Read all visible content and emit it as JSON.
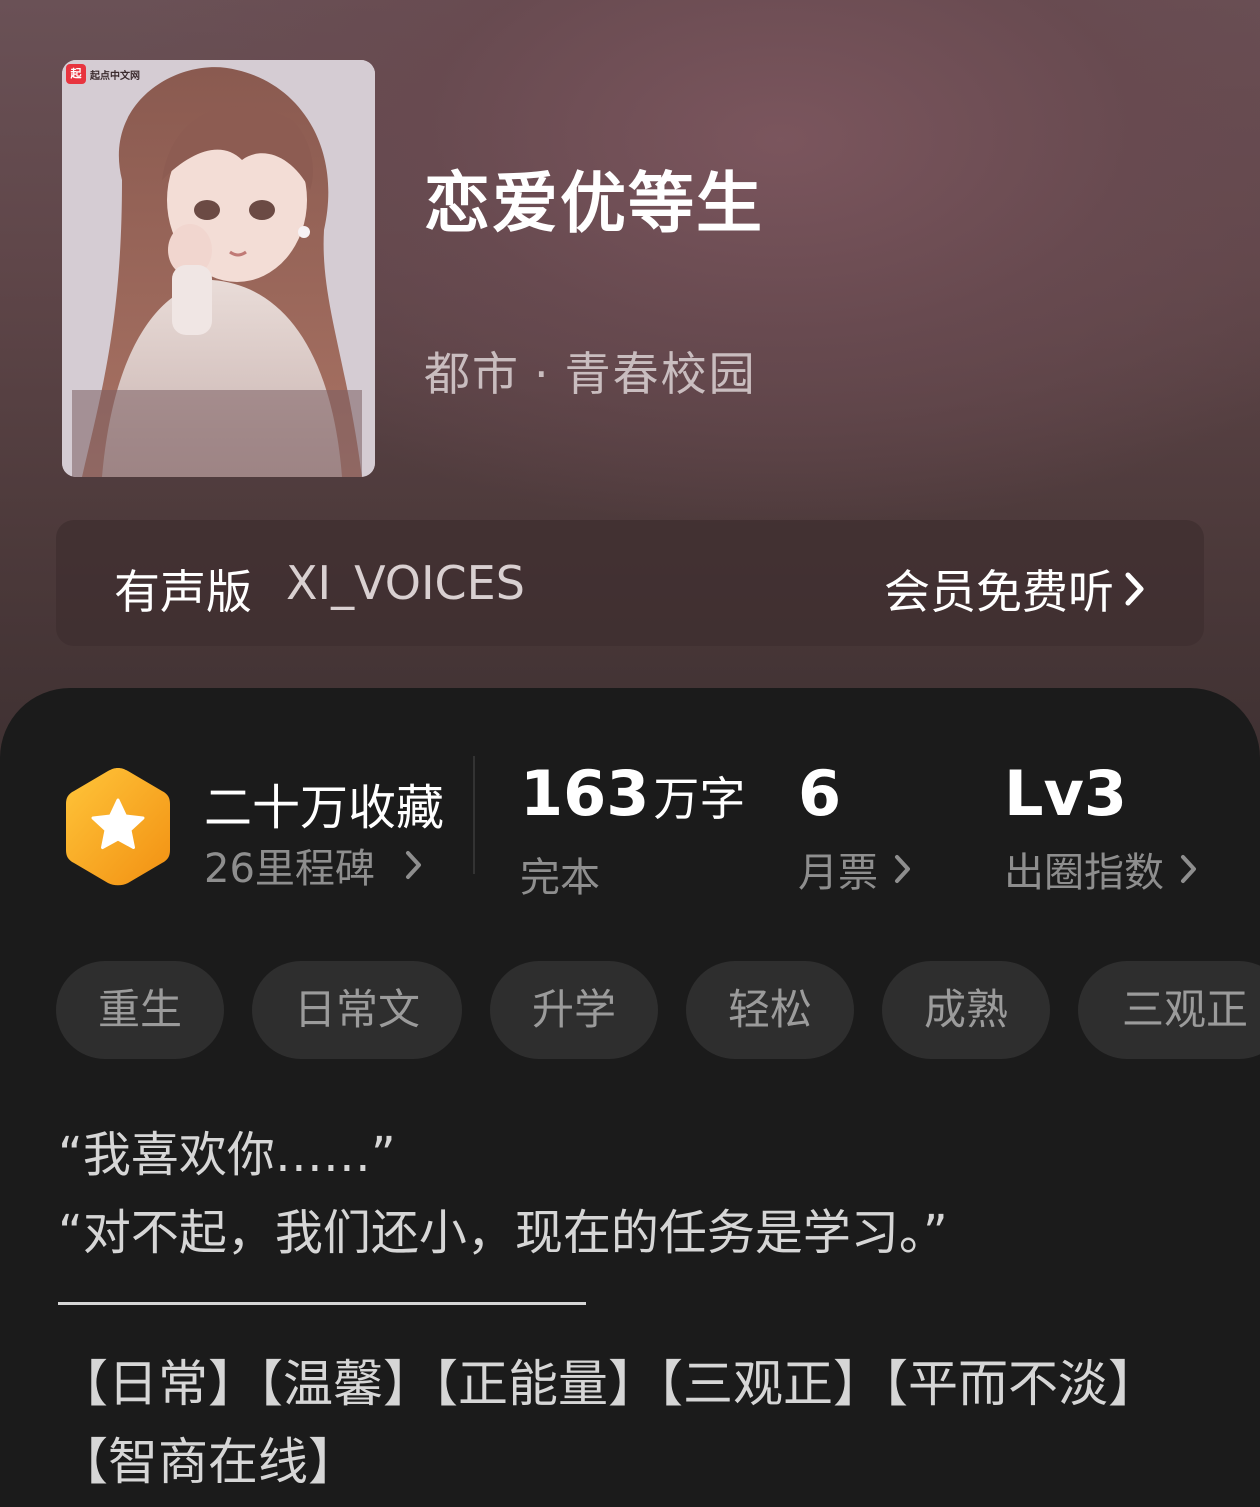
{
  "book": {
    "title": "恋爱优等生",
    "genre_main": "都市",
    "genre_dot": "·",
    "genre_sub": "青春校园",
    "cover_logo_text": "起点中文网",
    "cover_logo_mark": "起"
  },
  "audio": {
    "label": "有声版",
    "narrator": "XI_VOICES",
    "action": "会员免费听"
  },
  "stats": {
    "collect_title": "二十万收藏",
    "collect_sub": "26里程碑",
    "words_value": "163",
    "words_unit": "万字",
    "words_label": "完本",
    "tickets_value": "6",
    "tickets_label": "月票",
    "level_value": "Lv3",
    "level_label": "出圈指数"
  },
  "tags": [
    "重生",
    "日常文",
    "升学",
    "轻松",
    "成熟",
    "三观正"
  ],
  "description": {
    "line1": "“我喜欢你……”",
    "line2": "“对不起，我们还小，现在的任务是学习。”",
    "tags_text": "【日常】【温馨】【正能量】【三观正】【平而不淡】【智商在线】"
  },
  "colors": {
    "hero_bg": "#5f4649",
    "panel_bg": "#1b1b1b",
    "badge_orange": "#f6a21b",
    "tag_bg": "#2e2e2e",
    "muted_text": "#8e8e8e"
  },
  "icons": {
    "audio_chevron": "chevron-right-icon",
    "badge": "star-hexagon-icon"
  }
}
